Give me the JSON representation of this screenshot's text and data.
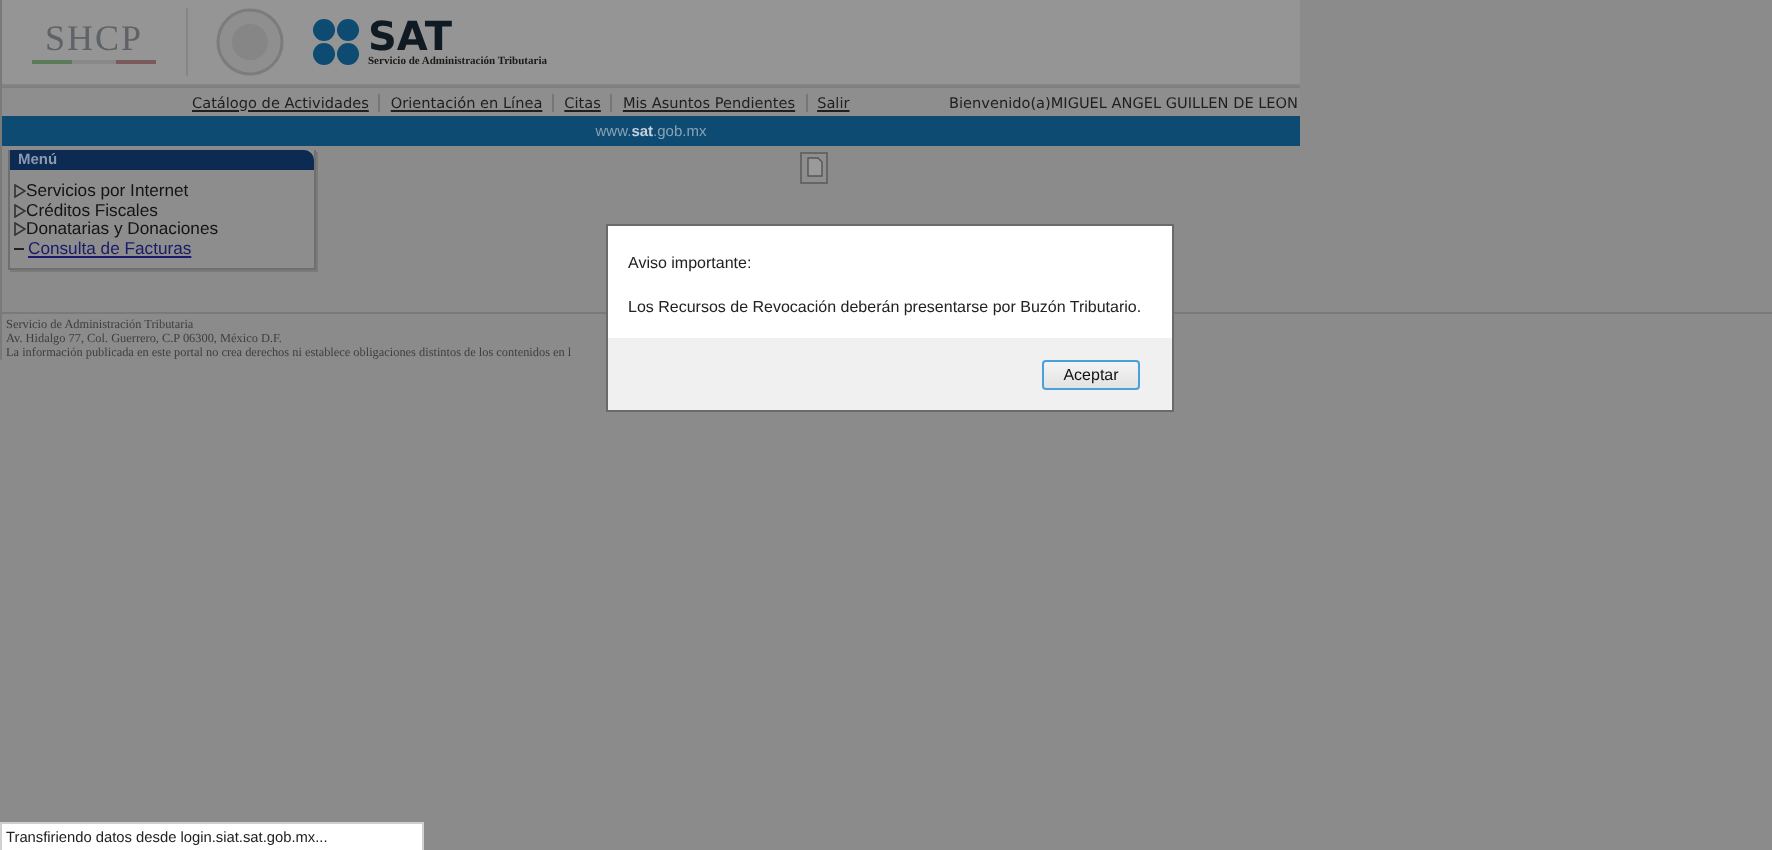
{
  "header": {
    "shcp_logo": "SHCP",
    "sat_logo": "SAT",
    "sat_subtitle": "Servicio de Administración Tributaria"
  },
  "nav": {
    "links": [
      "Catálogo de Actividades",
      "Orientación en Línea",
      "Citas",
      "Mis Asuntos Pendientes",
      "Salir"
    ],
    "welcome": "Bienvenido(a)MIGUEL ANGEL GUILLEN DE LEON"
  },
  "banner": "www.**sat**.gob.mx",
  "menu": {
    "title": "Menú",
    "items": [
      {
        "label": "Servicios por Internet",
        "kind": "folder"
      },
      {
        "label": "Créditos Fiscales",
        "kind": "folder"
      },
      {
        "label": "Donatarias y Donaciones",
        "kind": "folder"
      },
      {
        "label": "Consulta de Facturas",
        "kind": "link"
      }
    ]
  },
  "footer": [
    "Servicio de Administración Tributaria",
    "Av. Hidalgo 77, Col. Guerrero, C.P 06300, México D.F.",
    "La información publicada en este portal no crea derechos ni establece obligaciones distintos de los contenidos en l"
  ],
  "dialog": {
    "title": "Aviso importante:",
    "message": "Los Recursos de Revocación deberán presentarse por Buzón Tributario.",
    "button": "Aceptar"
  },
  "status_bar": "Transfiriendo datos desde login.siat.sat.gob.mx..."
}
